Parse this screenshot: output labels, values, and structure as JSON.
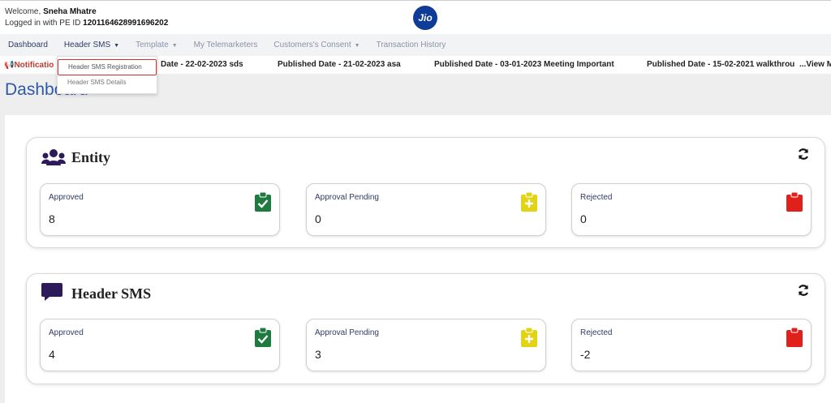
{
  "header": {
    "welcome_prefix": "Welcome,",
    "user_name": "Sneha Mhatre",
    "pe_prefix": "Logged in with PE ID",
    "pe_id": "1201164628991696202",
    "logo_text": "Jio"
  },
  "nav": {
    "items": [
      {
        "label": "Dashboard",
        "active": true,
        "caret": false
      },
      {
        "label": "Header SMS",
        "active": true,
        "caret": true
      },
      {
        "label": "Template",
        "active": false,
        "caret": true
      },
      {
        "label": "My Telemarketers",
        "active": false,
        "caret": false
      },
      {
        "label": "Customers's Consent",
        "active": false,
        "caret": true
      },
      {
        "label": "Transaction History",
        "active": false,
        "caret": false
      }
    ]
  },
  "dropdown": {
    "items": [
      "Header SMS Registration",
      "Header SMS Details"
    ]
  },
  "ticker": {
    "label": "Notificatio",
    "messages": [
      "Date - 22-02-2023 sds",
      "Published Date - 21-02-2023 asa",
      "Published Date - 03-01-2023 Meeting Important",
      "Published Date - 15-02-2021 walkthrou",
      "...View M"
    ]
  },
  "page_title": "Dashboard",
  "sections": {
    "entity": {
      "title": "Entity",
      "cards": [
        {
          "label": "Approved",
          "value": "8"
        },
        {
          "label": "Approval Pending",
          "value": "0"
        },
        {
          "label": "Rejected",
          "value": "0"
        }
      ]
    },
    "header_sms": {
      "title": "Header SMS",
      "cards": [
        {
          "label": "Approved",
          "value": "4"
        },
        {
          "label": "Approval Pending",
          "value": "3"
        },
        {
          "label": "Rejected",
          "value": "-2"
        }
      ]
    }
  },
  "colors": {
    "approved": "#1e7a3e",
    "pending": "#e2d415",
    "rejected": "#e0201b",
    "brand": "#0f3c96",
    "section_icon": "#2d1a5a"
  },
  "icons": {
    "approved": "clipboard-check-icon",
    "pending": "clipboard-plus-icon",
    "rejected": "clipboard-icon",
    "entity": "users-icon",
    "header_sms": "chat-bubble-icon",
    "refresh": "refresh-icon"
  }
}
